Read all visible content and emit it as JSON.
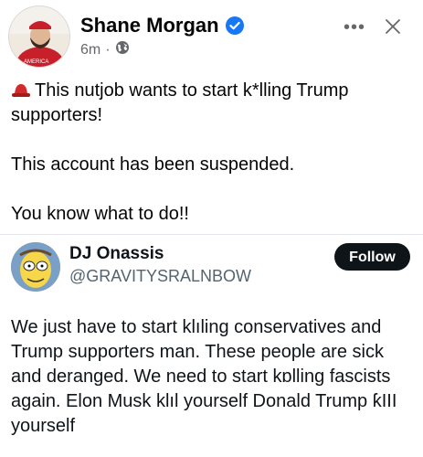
{
  "post": {
    "author": "Shane Morgan",
    "time": "6m",
    "dot": "·",
    "more_label": "•••",
    "lines": [
      "This nutjob wants to start k*lling Trump supporters!",
      "This account has been suspended.",
      "You know what to do!!"
    ]
  },
  "tweet": {
    "name": "DJ Onassis",
    "handle": "@GRAVITYSRALNBOW",
    "follow_label": "Follow",
    "text": "We just have to start klıling conservatives and Trump supporters man. These people are sick and deranged. We need to start kɒlling fascists again. Elon Musk klıl yourself Donald Trump ƙIII yourself"
  },
  "icons": {
    "verified": "verified-badge-icon",
    "globe": "globe-icon",
    "more": "more-options-icon",
    "close": "close-icon",
    "hat": "red-hat-emoji-icon"
  },
  "colors": {
    "verified": "#1877f2",
    "follow_bg": "#0f1419"
  }
}
